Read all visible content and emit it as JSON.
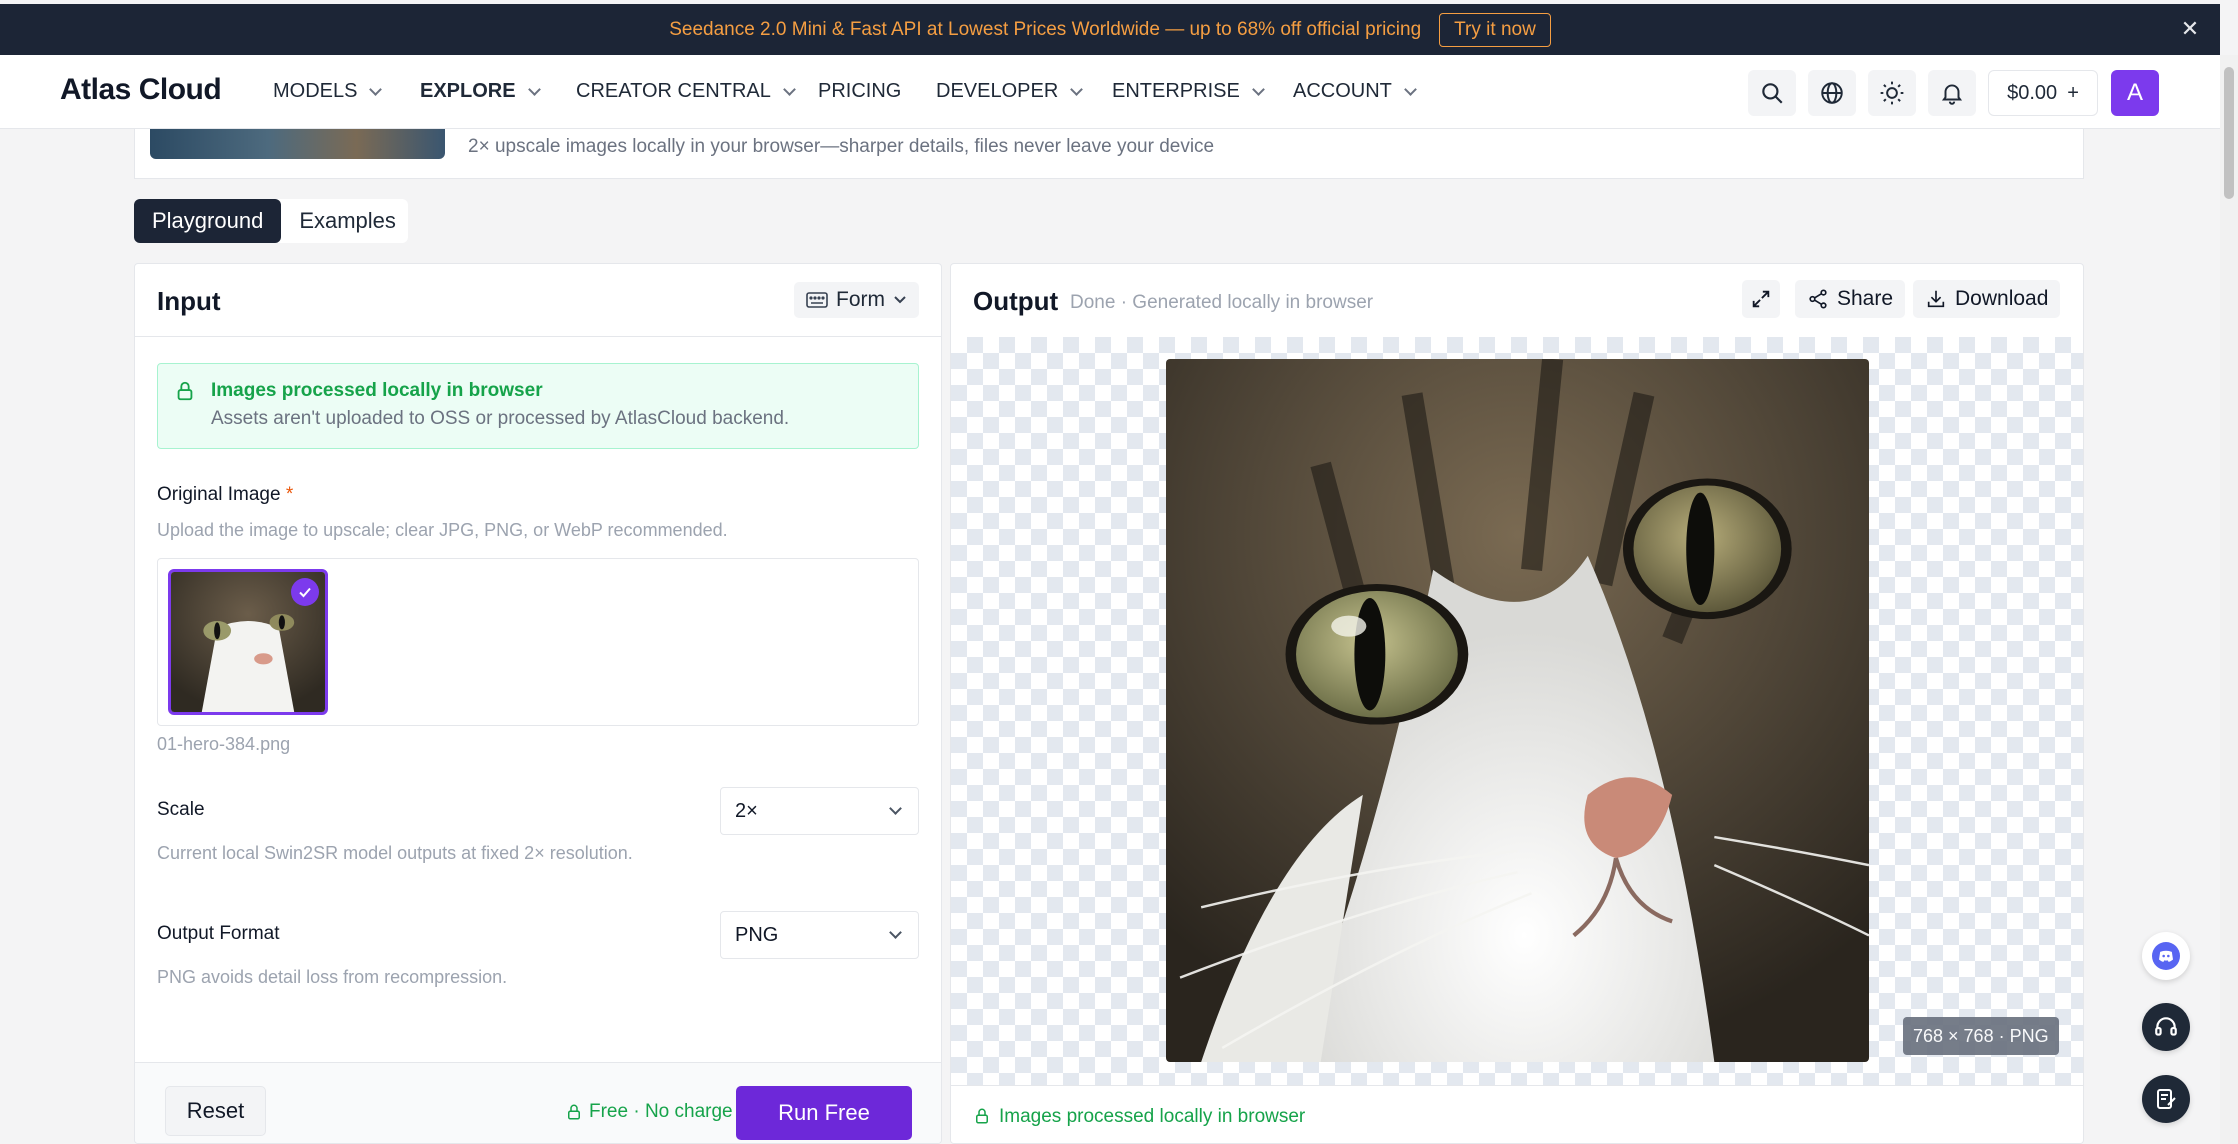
{
  "announcement": {
    "text": "Seedance 2.0 Mini & Fast API at Lowest Prices Worldwide — up to 68% off official pricing",
    "cta": "Try it now",
    "close": "✕"
  },
  "nav": {
    "logo": "Atlas Cloud",
    "items": [
      {
        "label": "MODELS"
      },
      {
        "label": "EXPLORE"
      },
      {
        "label": "CREATOR CENTRAL"
      },
      {
        "label": "PRICING"
      },
      {
        "label": "DEVELOPER"
      },
      {
        "label": "ENTERPRISE"
      },
      {
        "label": "ACCOUNT"
      }
    ],
    "balance": "$0.00",
    "balance_plus": "+",
    "avatar_initial": "A",
    "accent": "#7c3aed"
  },
  "header": {
    "description": "2× upscale images locally in your browser—sharper details, files never leave your device"
  },
  "tabs": [
    {
      "label": "Playground",
      "active": true
    },
    {
      "label": "Examples",
      "active": false
    }
  ],
  "input": {
    "title": "Input",
    "mode": "Form",
    "notice": {
      "title": "Images processed locally in browser",
      "subtitle": "Assets aren't uploaded to OSS or processed by AtlasCloud backend."
    },
    "original_image": {
      "label": "Original Image",
      "required_mark": "*",
      "help": "Upload the image to upscale; clear JPG, PNG, or WebP recommended.",
      "filename": "01-hero-384.png"
    },
    "scale": {
      "label": "Scale",
      "value": "2×",
      "help": "Current local Swin2SR model outputs at fixed 2× resolution."
    },
    "output_format": {
      "label": "Output Format",
      "value": "PNG",
      "help": "PNG avoids detail loss from recompression."
    },
    "footer": {
      "reset": "Reset",
      "free_note": "Free · No charge",
      "run": "Run Free"
    }
  },
  "output": {
    "title": "Output",
    "status": "Done · Generated locally in browser",
    "share": "Share",
    "download": "Download",
    "dimensions": "768 × 768 · PNG",
    "footer_note": "Images processed locally in browser"
  },
  "icons": {
    "search": "search-icon",
    "globe": "globe-icon",
    "theme": "sun-icon",
    "notifications": "bell-icon",
    "discord": "discord-icon",
    "support": "headset-icon",
    "feedback": "feedback-icon"
  }
}
